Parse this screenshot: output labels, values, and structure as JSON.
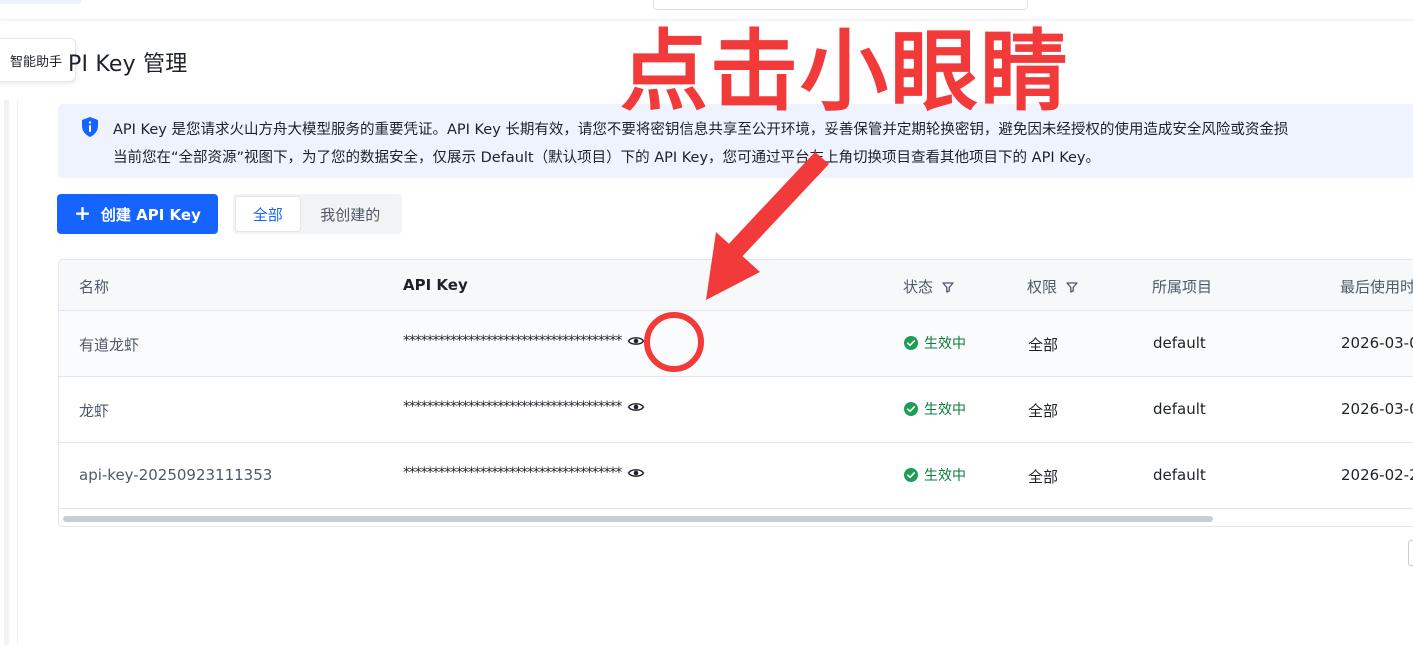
{
  "sidebar": {
    "assistant_label": "智能助手"
  },
  "page": {
    "title": "PI Key 管理"
  },
  "notice": {
    "line1": "API Key 是您请求火山方舟大模型服务的重要凭证。API Key 长期有效，请您不要将密钥信息共享至公开环境，妥善保管并定期轮换密钥，避免因未经授权的使用造成安全风险或资金损",
    "line2": "当前您在“全部资源”视图下，为了您的数据安全，仅展示 Default（默认项目）下的 API Key，您可通过平台左上角切换项目查看其他项目下的 API Key。"
  },
  "toolbar": {
    "create_label": "创建 API Key",
    "create_icon": "plus-icon",
    "filter_all": "全部",
    "filter_mine": "我创建的"
  },
  "table": {
    "columns": {
      "name": "名称",
      "api_key": "API Key",
      "status": "状态",
      "permission": "权限",
      "project": "所属项目",
      "last_used": "最后使用时"
    },
    "rows": [
      {
        "name": "有道龙虾",
        "api_key": "*************************************",
        "status": "生效中",
        "permission": "全部",
        "project": "default",
        "last_used": "2026-03-0"
      },
      {
        "name": "龙虾",
        "api_key": "*************************************",
        "status": "生效中",
        "permission": "全部",
        "project": "default",
        "last_used": "2026-03-0"
      },
      {
        "name": "api-key-20250923111353",
        "api_key": "*************************************",
        "status": "生效中",
        "permission": "全部",
        "project": "default",
        "last_used": "2026-02-2"
      }
    ]
  },
  "annotation": {
    "text": "点击小眼睛",
    "color": "#f23a3a"
  },
  "colors": {
    "primary": "#1664ff",
    "status_active": "#0e7c3a",
    "notice_bg": "#eef3fe"
  }
}
